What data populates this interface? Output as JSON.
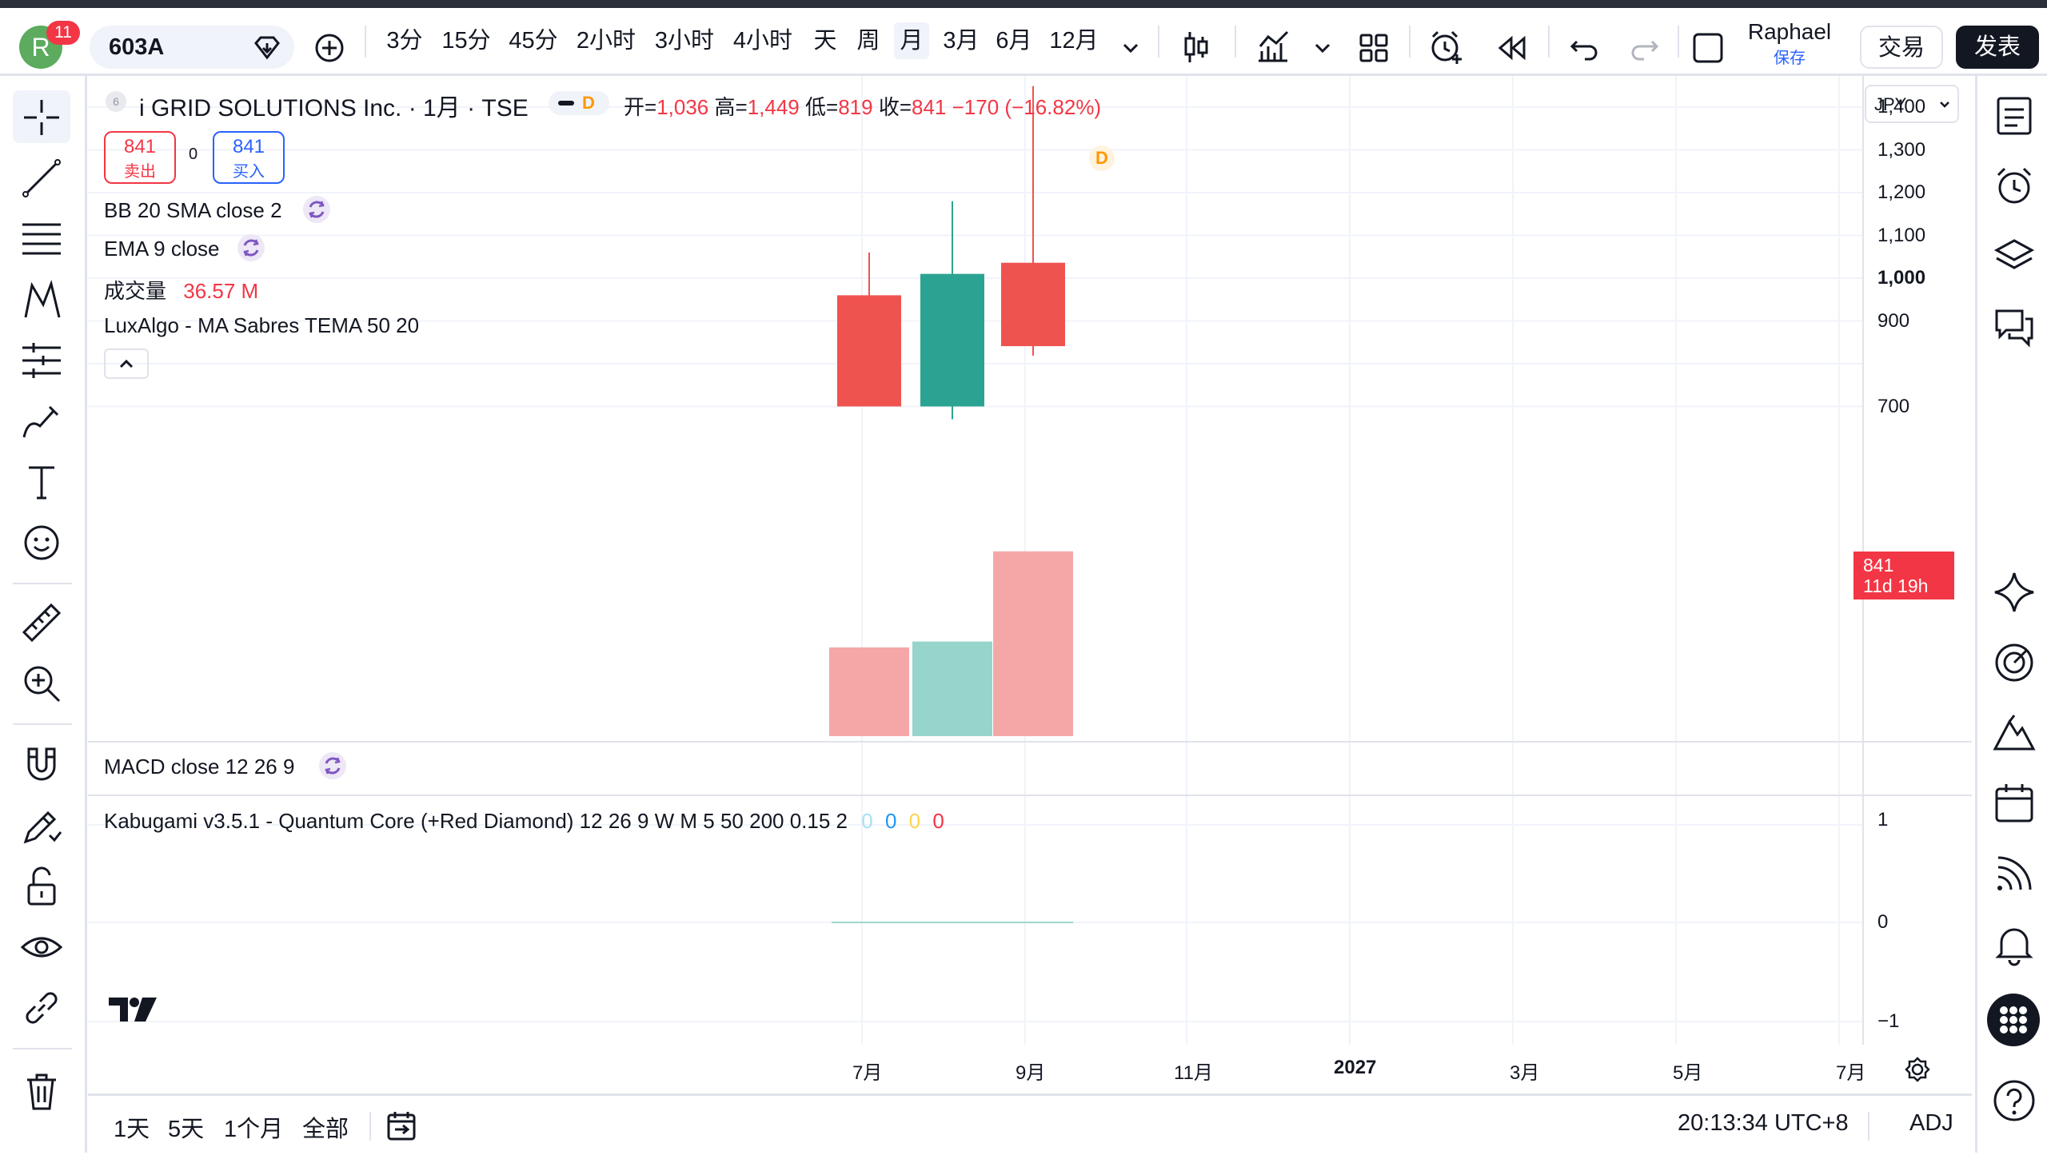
{
  "toolbar": {
    "avatar_letter": "R",
    "notification_count": "11",
    "symbol": "603A",
    "timeframes": [
      "3分",
      "15分",
      "45分",
      "2小时",
      "3小时",
      "4小时",
      "天",
      "周",
      "月",
      "3月",
      "6月",
      "12月"
    ],
    "active_timeframe": "月",
    "user_name": "Raphael",
    "save_label": "保存",
    "trade_label": "交易",
    "publish_label": "发表"
  },
  "legend": {
    "title": "i GRID SOLUTIONS Inc. · 1月 · TSE",
    "badge": "D",
    "open_label": "开=",
    "open": "1,036",
    "high_label": "高=",
    "high": "1,449",
    "low_label": "低=",
    "low": "819",
    "close_label": "收=",
    "close": "841",
    "change": "−170 (−16.82%)",
    "sell_price": "841",
    "sell_label": "卖出",
    "spread": "0",
    "buy_price": "841",
    "buy_label": "买入",
    "indicators": [
      "BB 20 SMA close 2",
      "EMA 9 close"
    ],
    "volume_label": "成交量",
    "volume_value": "36.57 M",
    "luxalgo": "LuxAlgo - MA Sabres TEMA 50 20",
    "macd": "MACD close 12 26 9",
    "kabugami": "Kabugami v3.5.1 - Quantum Core (+Red Diamond) 12 26 9 W M 5 50 200 0.15 2",
    "kabugami_values": [
      "0",
      "0",
      "0",
      "0"
    ]
  },
  "currency": "JPY",
  "price_tag": {
    "price": "841",
    "countdown": "11d 19h"
  },
  "chart_data": {
    "type": "candlestick",
    "y_ticks": [
      1400,
      1300,
      1200,
      1100,
      1000,
      900,
      700
    ],
    "y_tick_labels": [
      "1,400",
      "1,300",
      "1,200",
      "1,100",
      "1,000",
      "900",
      "700"
    ],
    "x_tick_labels": [
      "7月",
      "9月",
      "11月",
      "2027",
      "3月",
      "5月",
      "7月"
    ],
    "candles": [
      {
        "open": 960,
        "high": 1060,
        "low": 700,
        "close": 700,
        "direction": "down",
        "volume": 0.3
      },
      {
        "open": 700,
        "high": 1180,
        "low": 670,
        "close": 1010,
        "direction": "up",
        "volume": 0.32
      },
      {
        "open": 1036,
        "high": 1449,
        "low": 819,
        "close": 841,
        "direction": "down",
        "volume": 0.625
      }
    ],
    "sub_y_tick_labels": [
      "1",
      "0",
      "−1"
    ],
    "up_color": "#2ba392",
    "down_color": "#ef5350",
    "up_volume_color": "#97d4cb",
    "down_volume_color": "#f5a7a7"
  },
  "bottom": {
    "ranges": [
      "1天",
      "5天",
      "1个月",
      "全部"
    ],
    "clock": "20:13:34 UTC+8",
    "adj": "ADJ"
  }
}
